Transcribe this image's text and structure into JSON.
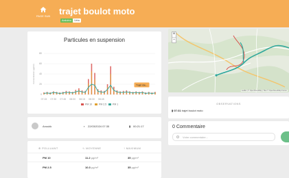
{
  "header": {
    "home_label": "PAGE SUB",
    "title": "trajet boulot moto",
    "tags": [
      "Arduino",
      "Vélo"
    ]
  },
  "chart": {
    "title": "Particules en suspension",
    "ylabel": "Concentration (µg/m³)",
    "tooltip": "Trajet dou...",
    "legend": [
      "PM 10",
      "PM 2.5",
      "PM 1"
    ],
    "colors": {
      "pm10": "#d9534f",
      "pm25": "#e0a030",
      "pm1": "#3aa89a"
    }
  },
  "chart_data": {
    "type": "line",
    "x": [
      "07:15",
      "07:20",
      "07:25",
      "07:30",
      "07:35",
      "07:40",
      "07:45",
      "07:50",
      "07:55",
      "08:00",
      "08:05",
      "08:10",
      "08:15",
      "08:20",
      "08:25",
      "08:30",
      "08:35",
      "08:40",
      "08:45",
      "08:50",
      "08:55",
      "09:00",
      "09:05",
      "09:10",
      "09:15",
      "09:20",
      "09:25",
      "09:30",
      "09:35",
      "09:40",
      "09:45",
      "09:50",
      "09:55",
      "10:00",
      "10:05",
      "10:10"
    ],
    "xticks": [
      "07:15",
      "07:30",
      "07:45",
      "08:00",
      "08:15",
      "08:30",
      "08:45"
    ],
    "series": [
      {
        "name": "PM 10",
        "values": [
          4,
          5,
          4,
          6,
          5,
          4,
          5,
          7,
          6,
          5,
          9,
          12,
          8,
          7,
          30,
          60,
          42,
          10,
          8,
          7,
          20,
          55,
          15,
          8,
          6,
          7,
          8,
          6,
          5,
          6,
          5,
          6,
          4,
          5,
          4,
          5
        ]
      },
      {
        "name": "PM 2.5",
        "values": [
          3,
          4,
          3,
          5,
          4,
          3,
          4,
          5,
          5,
          4,
          7,
          9,
          6,
          5,
          22,
          45,
          30,
          8,
          6,
          5,
          15,
          40,
          11,
          6,
          5,
          5,
          6,
          5,
          4,
          5,
          4,
          5,
          3,
          4,
          3,
          4
        ]
      },
      {
        "name": "PM 1",
        "values": [
          2,
          3,
          2,
          4,
          3,
          2,
          3,
          4,
          4,
          3,
          5,
          7,
          5,
          4,
          14,
          20,
          18,
          6,
          5,
          4,
          10,
          18,
          8,
          5,
          4,
          4,
          5,
          4,
          3,
          4,
          3,
          4,
          2,
          3,
          2,
          3
        ]
      }
    ],
    "ylim": [
      0,
      80
    ]
  },
  "map": {
    "zoom_in": "+",
    "zoom_out": "−",
    "attribution": "Leaflet | © OpenStreetMap | Tiles © OpenStreetMap France"
  },
  "observations": {
    "header": "OBSERVATIONS",
    "time": "07:31",
    "text": "trajet boulot moto"
  },
  "comments": {
    "title": "0 Commentaire",
    "placeholder": "Votre commentaire..."
  },
  "meta": {
    "author": "Anoukk",
    "date": "22/03/2024 07:35",
    "duration": "00:21:17"
  },
  "table": {
    "headers": [
      "POLLUANT",
      "MOYENNE",
      "MAXIMUM"
    ],
    "rows": [
      {
        "name": "PM 10",
        "avg": "11.2",
        "max": "35"
      },
      {
        "name": "PM 2.5",
        "avg": "10.3",
        "max": "35"
      }
    ],
    "unit": "µg/m³"
  }
}
